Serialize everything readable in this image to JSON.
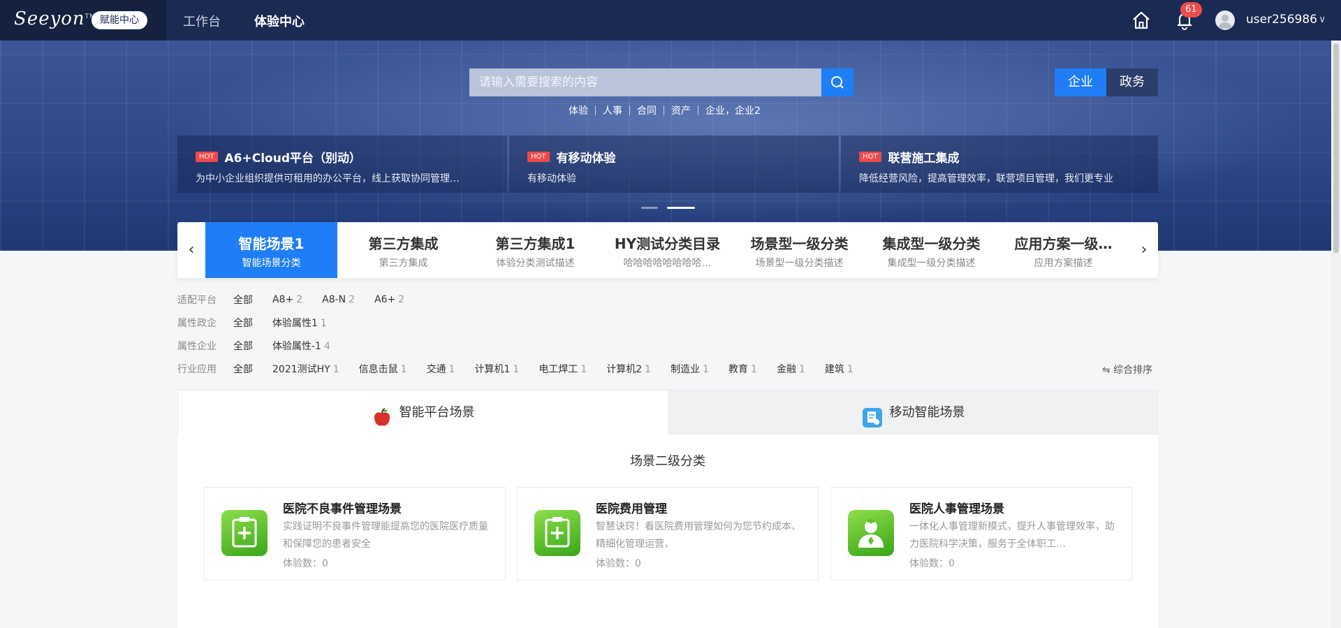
{
  "brand": {
    "logo_text": "Seeyon",
    "tm": "TM",
    "badge": "赋能中心"
  },
  "nav": [
    {
      "label": "工作台",
      "active": false
    },
    {
      "label": "体验中心",
      "active": true
    }
  ],
  "header_right": {
    "notifications": "61",
    "username": "user256986",
    "caret": "∨"
  },
  "search": {
    "placeholder": "请输入需要搜索的内容",
    "hot_words": [
      "体验",
      "人事",
      "合同",
      "资产",
      "企业，企业2"
    ],
    "segments": [
      {
        "label": "企业",
        "active": true
      },
      {
        "label": "政务",
        "active": false
      }
    ]
  },
  "hot_cards": [
    {
      "tag": "HOT",
      "title": "A6+Cloud平台（别动）",
      "desc": "为中小企业组织提供可租用的办公平台，线上获取协同管理…"
    },
    {
      "tag": "HOT",
      "title": "有移动体验",
      "desc": "有移动体验"
    },
    {
      "tag": "HOT",
      "title": "联营施工集成",
      "desc": "降低经营风险，提高管理效率，联营项目管理，我们更专业"
    }
  ],
  "categories": {
    "prev": "‹",
    "next": "›",
    "items": [
      {
        "title": "智能场景1",
        "desc": "智能场景分类",
        "active": true
      },
      {
        "title": "第三方集成",
        "desc": "第三方集成",
        "active": false
      },
      {
        "title": "第三方集成1",
        "desc": "体验分类测试描述",
        "active": false
      },
      {
        "title": "HY测试分类目录",
        "desc": "哈哈哈哈哈哈哈哈…",
        "active": false
      },
      {
        "title": "场景型一级分类",
        "desc": "场景型一级分类描述",
        "active": false
      },
      {
        "title": "集成型一级分类",
        "desc": "集成型一级分类描述",
        "active": false
      },
      {
        "title": "应用方案一级…",
        "desc": "应用方案描述",
        "active": false
      }
    ]
  },
  "filters": [
    {
      "label": "适配平台",
      "options": [
        {
          "name": "全部",
          "count": ""
        },
        {
          "name": "A8+",
          "count": "2"
        },
        {
          "name": "A8-N",
          "count": "2"
        },
        {
          "name": "A6+",
          "count": "2"
        }
      ]
    },
    {
      "label": "属性政企",
      "options": [
        {
          "name": "全部",
          "count": ""
        },
        {
          "name": "体验属性1",
          "count": "1"
        }
      ]
    },
    {
      "label": "属性企业",
      "options": [
        {
          "name": "全部",
          "count": ""
        },
        {
          "name": "体验属性-1",
          "count": "4"
        }
      ]
    },
    {
      "label": "行业应用",
      "options": [
        {
          "name": "全部",
          "count": ""
        },
        {
          "name": "2021测试HY",
          "count": "1"
        },
        {
          "name": "信息击鼠",
          "count": "1"
        },
        {
          "name": "交通",
          "count": "1"
        },
        {
          "name": "计算机1",
          "count": "1"
        },
        {
          "name": "电工焊工",
          "count": "1"
        },
        {
          "name": "计算机2",
          "count": "1"
        },
        {
          "name": "制造业",
          "count": "1"
        },
        {
          "name": "教育",
          "count": "1"
        },
        {
          "name": "金融",
          "count": "1"
        },
        {
          "name": "建筑",
          "count": "1"
        }
      ]
    }
  ],
  "sort_label": "⇋ 综合排序",
  "tabs": [
    {
      "label": "智能平台场景",
      "icon": "apple-icon",
      "active": true
    },
    {
      "label": "移动智能场景",
      "icon": "mobile-app-icon",
      "active": false
    }
  ],
  "section_title": "场景二级分类",
  "scenes": [
    {
      "title": "医院不良事件管理场景",
      "desc": "实践证明不良事件管理能提高您的医院医疗质量和保障您的患者安全",
      "count_label": "体验数：0",
      "icon": "medical-kit-icon"
    },
    {
      "title": "医院费用管理",
      "desc": "智慧诀窍！看医院费用管理如何为您节约成本、精细化管理运营，",
      "count_label": "体验数：0",
      "icon": "medical-kit-icon"
    },
    {
      "title": "医院人事管理场景",
      "desc": "一体化人事管理新模式，提升人事管理效率，助力医院科学决策，服务于全体职工…",
      "count_label": "体验数：0",
      "icon": "doctor-icon"
    }
  ]
}
